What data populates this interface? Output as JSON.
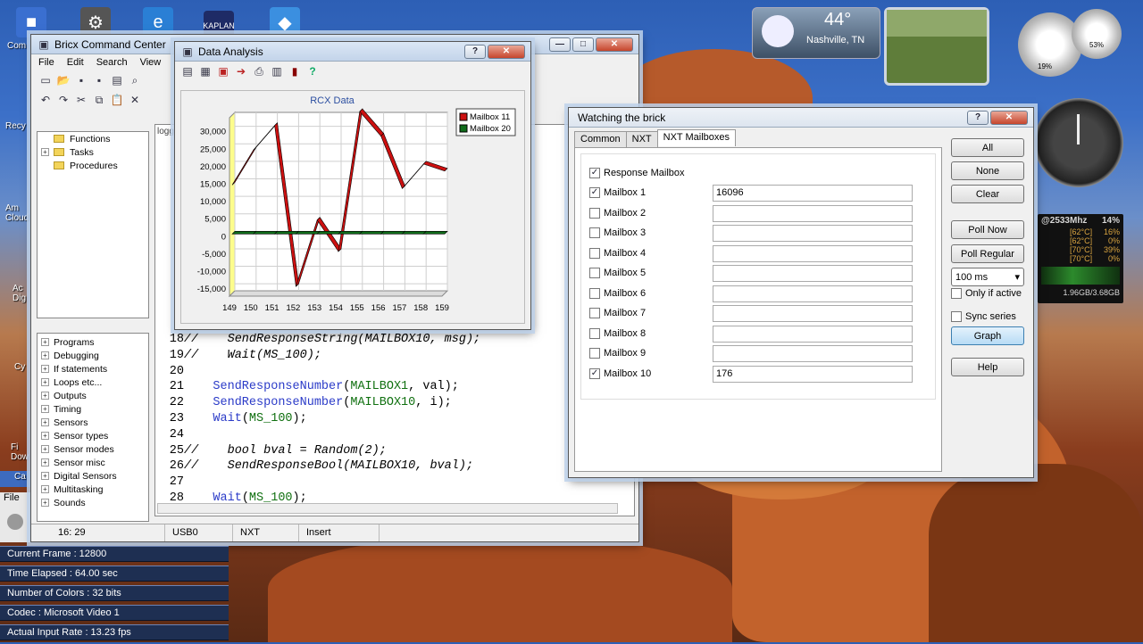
{
  "desktop": {
    "weather": {
      "temp": "44°",
      "location": "Nashville, TN"
    },
    "cpu_meter": {
      "cpu": "19%",
      "mem": "53%"
    },
    "cpu_info": {
      "freq": "@2533Mhz",
      "pct": "14%",
      "cores": [
        {
          "temp": "[62°C]",
          "load": "16%"
        },
        {
          "temp": "[62°C]",
          "load": "0%"
        },
        {
          "temp": "[70°C]",
          "load": "39%"
        },
        {
          "temp": "[70°C]",
          "load": "0%"
        }
      ],
      "mem": "1.96GB/3.68GB"
    },
    "icon_labels": [
      "Com",
      "Recy",
      "Am Cloud",
      "Ac Dig",
      "Cy",
      "Fi Dow",
      "Ca",
      "File"
    ]
  },
  "bricx": {
    "title": "Bricx Command Center",
    "menu": [
      "File",
      "Edit",
      "Search",
      "View"
    ],
    "doc_tab": "logg",
    "templates_tree": [
      "Functions",
      "Tasks",
      "Procedures"
    ],
    "code_tree": [
      "Programs",
      "Debugging",
      "If statements",
      "Loops etc...",
      "Outputs",
      "Timing",
      "Sensors",
      "Sensor types",
      "Sensor modes",
      "Sensor misc",
      "Digital Sensors",
      "Multitasking",
      "Sounds"
    ],
    "code_lines": [
      {
        "n": "18",
        "parts": [
          {
            "c": "cm",
            "t": "//    SendResponseString(MAILBOX10, msg);"
          }
        ]
      },
      {
        "n": "19",
        "parts": [
          {
            "c": "cm",
            "t": "//    Wait(MS_100);"
          }
        ]
      },
      {
        "n": "20",
        "parts": []
      },
      {
        "n": "21",
        "parts": [
          {
            "c": "kw",
            "t": "    SendResponseNumber"
          },
          {
            "c": "",
            "t": "("
          },
          {
            "c": "ct",
            "t": "MAILBOX1"
          },
          {
            "c": "",
            "t": ", val);"
          }
        ]
      },
      {
        "n": "22",
        "parts": [
          {
            "c": "kw",
            "t": "    SendResponseNumber"
          },
          {
            "c": "",
            "t": "("
          },
          {
            "c": "ct",
            "t": "MAILBOX10"
          },
          {
            "c": "",
            "t": ", i);"
          }
        ]
      },
      {
        "n": "23",
        "parts": [
          {
            "c": "kw",
            "t": "    Wait"
          },
          {
            "c": "",
            "t": "("
          },
          {
            "c": "ct",
            "t": "MS_100"
          },
          {
            "c": "",
            "t": ");"
          }
        ]
      },
      {
        "n": "24",
        "parts": []
      },
      {
        "n": "25",
        "parts": [
          {
            "c": "cm",
            "t": "//    bool bval = Random(2);"
          }
        ]
      },
      {
        "n": "26",
        "parts": [
          {
            "c": "cm",
            "t": "//    SendResponseBool(MAILBOX10, bval);"
          }
        ]
      },
      {
        "n": "27",
        "parts": []
      },
      {
        "n": "28",
        "parts": [
          {
            "c": "kw",
            "t": "    Wait"
          },
          {
            "c": "",
            "t": "("
          },
          {
            "c": "ct",
            "t": "MS_100"
          },
          {
            "c": "",
            "t": ");"
          }
        ]
      }
    ],
    "status": [
      "16: 29",
      "USB0",
      "NXT",
      "Insert"
    ]
  },
  "data_analysis": {
    "title": "Data Analysis"
  },
  "chart_data": {
    "type": "line",
    "title": "RCX Data",
    "x": [
      149,
      150,
      151,
      152,
      153,
      154,
      155,
      156,
      157,
      158,
      159
    ],
    "series": [
      {
        "name": "Mailbox 11",
        "color": "#cc1010",
        "values": [
          14000,
          24000,
          31000,
          -15000,
          4000,
          -5000,
          35000,
          28000,
          13000,
          20000,
          18000
        ]
      },
      {
        "name": "Mailbox 20",
        "color": "#0f6b1a",
        "values": [
          0,
          0,
          0,
          0,
          0,
          0,
          0,
          0,
          0,
          0,
          0
        ]
      }
    ],
    "yticks": [
      "30,000",
      "25,000",
      "20,000",
      "15,000",
      "10,000",
      "5,000",
      "0",
      "-5,000",
      "-10,000",
      "-15,000"
    ],
    "ylim": [
      -17000,
      34000
    ]
  },
  "watch": {
    "title": "Watching the brick",
    "tabs": [
      "Common",
      "NXT",
      "NXT Mailboxes"
    ],
    "response_mailbox": {
      "label": "Response Mailbox",
      "checked": true
    },
    "mailboxes": [
      {
        "label": "Mailbox 1",
        "checked": true,
        "value": "16096"
      },
      {
        "label": "Mailbox 2",
        "checked": false,
        "value": ""
      },
      {
        "label": "Mailbox 3",
        "checked": false,
        "value": ""
      },
      {
        "label": "Mailbox 4",
        "checked": false,
        "value": ""
      },
      {
        "label": "Mailbox 5",
        "checked": false,
        "value": ""
      },
      {
        "label": "Mailbox 6",
        "checked": false,
        "value": ""
      },
      {
        "label": "Mailbox 7",
        "checked": false,
        "value": ""
      },
      {
        "label": "Mailbox 8",
        "checked": false,
        "value": ""
      },
      {
        "label": "Mailbox 9",
        "checked": false,
        "value": ""
      },
      {
        "label": "Mailbox 10",
        "checked": true,
        "value": "176"
      }
    ],
    "buttons": {
      "all": "All",
      "none": "None",
      "clear": "Clear",
      "poll_now": "Poll Now",
      "poll_regular": "Poll Regular",
      "graph": "Graph",
      "help": "Help"
    },
    "interval": "100 ms",
    "only_if_active": "Only if active",
    "sync_series": "Sync series"
  },
  "recorder_stats": [
    "Current Frame : 12800",
    "Time Elapsed : 64.00 sec",
    "Number of Colors : 32 bits",
    "Codec : Microsoft Video 1",
    "Actual Input Rate : 13.23 fps"
  ]
}
